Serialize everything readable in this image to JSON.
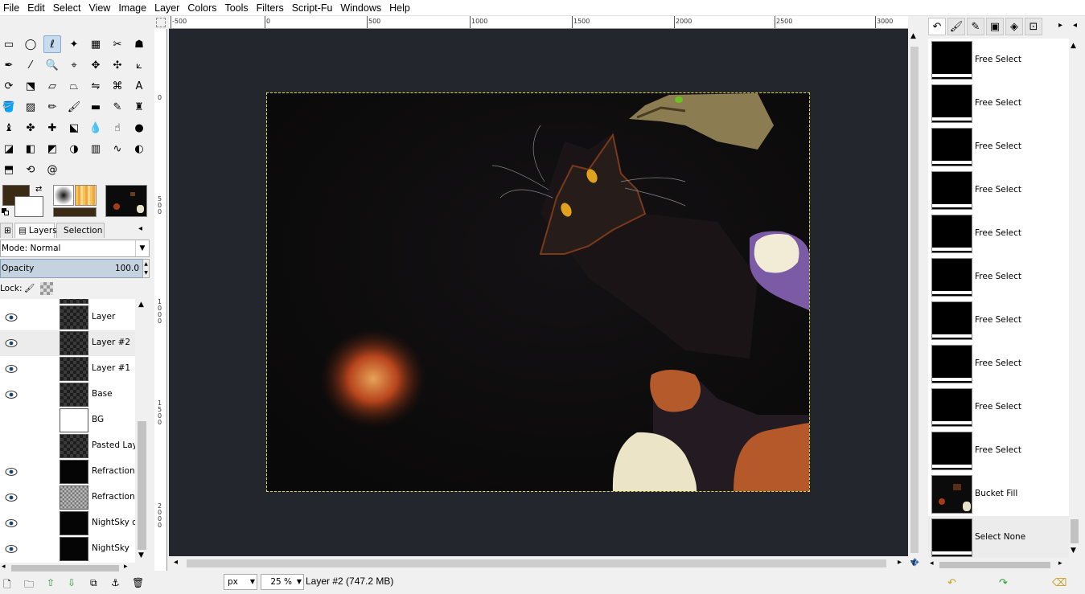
{
  "menu": [
    "File",
    "Edit",
    "Select",
    "View",
    "Image",
    "Layer",
    "Colors",
    "Tools",
    "Filters",
    "Script-Fu",
    "Windows",
    "Help"
  ],
  "toolbox": {
    "tools": [
      {
        "name": "rect-select-icon",
        "glyph": "▭"
      },
      {
        "name": "ellipse-select-icon",
        "glyph": "◯"
      },
      {
        "name": "free-select-icon",
        "glyph": "ℓ",
        "active": true
      },
      {
        "name": "fuzzy-select-icon",
        "glyph": "✦"
      },
      {
        "name": "select-by-color-icon",
        "glyph": "▦"
      },
      {
        "name": "scissors-select-icon",
        "glyph": "✂"
      },
      {
        "name": "foreground-select-icon",
        "glyph": "☗"
      },
      {
        "name": "paths-icon",
        "glyph": "✒"
      },
      {
        "name": "color-picker-icon",
        "glyph": "⁄"
      },
      {
        "name": "zoom-icon",
        "glyph": "🔍"
      },
      {
        "name": "measure-icon",
        "glyph": "⌖"
      },
      {
        "name": "move-icon",
        "glyph": "✥"
      },
      {
        "name": "alignment-icon",
        "glyph": "✣"
      },
      {
        "name": "crop-icon",
        "glyph": "⟀"
      },
      {
        "name": "rotate-icon",
        "glyph": "⟳"
      },
      {
        "name": "scale-icon",
        "glyph": "⬔"
      },
      {
        "name": "shear-icon",
        "glyph": "▱"
      },
      {
        "name": "perspective-icon",
        "glyph": "⏢"
      },
      {
        "name": "flip-icon",
        "glyph": "⇋"
      },
      {
        "name": "cage-transform-icon",
        "glyph": "⌘"
      },
      {
        "name": "text-icon",
        "glyph": "A"
      },
      {
        "name": "bucket-fill-icon",
        "glyph": "🪣"
      },
      {
        "name": "blend-icon",
        "glyph": "▨"
      },
      {
        "name": "pencil-icon",
        "glyph": "✏"
      },
      {
        "name": "paintbrush-icon",
        "glyph": "🖌"
      },
      {
        "name": "eraser-icon",
        "glyph": "▬"
      },
      {
        "name": "airbrush-icon",
        "glyph": "✎"
      },
      {
        "name": "ink-icon",
        "glyph": "♜"
      },
      {
        "name": "mypaint-brush-icon",
        "glyph": "♝"
      },
      {
        "name": "clone-icon",
        "glyph": "✤"
      },
      {
        "name": "heal-icon",
        "glyph": "✚"
      },
      {
        "name": "perspective-clone-icon",
        "glyph": "⬕"
      },
      {
        "name": "blur-icon",
        "glyph": "💧"
      },
      {
        "name": "smudge-icon",
        "glyph": "☝"
      },
      {
        "name": "dodge-burn-icon",
        "glyph": "●"
      },
      {
        "name": "warp-icon",
        "glyph": "◪"
      },
      {
        "name": "color-balance-icon",
        "glyph": "◧"
      },
      {
        "name": "hue-saturation-icon",
        "glyph": "◩"
      },
      {
        "name": "colorize-icon",
        "glyph": "◑"
      },
      {
        "name": "levels-icon",
        "glyph": "▥"
      },
      {
        "name": "curves-icon",
        "glyph": "∿"
      },
      {
        "name": "brightness-contrast-icon",
        "glyph": "◐"
      },
      {
        "name": "threshold-icon",
        "glyph": "⬒"
      },
      {
        "name": "desaturate-icon",
        "glyph": "⟲"
      },
      {
        "name": "spiral-icon",
        "glyph": "@"
      }
    ]
  },
  "colors": {
    "foreground": "#3b2b15",
    "background": "#ffffff",
    "accent": "#c9dcef"
  },
  "dock": {
    "tabs": [
      {
        "label": "Layers",
        "active": true
      },
      {
        "label": "Selection",
        "active": false
      }
    ],
    "mode_label": "Mode: Normal",
    "opacity_label": "Opacity",
    "opacity_value": "100.0",
    "lock_label": "Lock:",
    "layers": [
      {
        "name": "Layer",
        "visible": true,
        "thumb": "checker",
        "selected": false
      },
      {
        "name": "Layer #2",
        "visible": true,
        "thumb": "checker",
        "selected": true
      },
      {
        "name": "Layer #1",
        "visible": true,
        "thumb": "checker",
        "selected": false
      },
      {
        "name": "Base",
        "visible": true,
        "thumb": "checker",
        "selected": false
      },
      {
        "name": "BG",
        "visible": false,
        "thumb": "white",
        "selected": false
      },
      {
        "name": "Pasted Laye",
        "visible": false,
        "thumb": "checker",
        "selected": false
      },
      {
        "name": "RefractionL",
        "visible": true,
        "thumb": "black",
        "selected": false
      },
      {
        "name": "RefractionL",
        "visible": true,
        "thumb": "noise",
        "selected": false
      },
      {
        "name": "NightSky co",
        "visible": true,
        "thumb": "black",
        "selected": false
      },
      {
        "name": "NightSky",
        "visible": true,
        "thumb": "black",
        "selected": false
      }
    ]
  },
  "rulers": {
    "horizontal": [
      "-500",
      "0",
      "500",
      "1000",
      "1500",
      "2000",
      "2500",
      "3000"
    ],
    "vertical": [
      "0",
      "500",
      "1000",
      "1500",
      "2000"
    ]
  },
  "statusbar": {
    "unit": "px",
    "zoom": "25 %",
    "info": "Layer #2 (747.2 MB)"
  },
  "history": {
    "items": [
      {
        "label": "Free Select",
        "thumb": "black",
        "selected": false
      },
      {
        "label": "Free Select",
        "thumb": "black",
        "selected": false
      },
      {
        "label": "Free Select",
        "thumb": "black",
        "selected": false
      },
      {
        "label": "Free Select",
        "thumb": "black",
        "selected": false
      },
      {
        "label": "Free Select",
        "thumb": "black",
        "selected": false
      },
      {
        "label": "Free Select",
        "thumb": "black",
        "selected": false
      },
      {
        "label": "Free Select",
        "thumb": "black",
        "selected": false
      },
      {
        "label": "Free Select",
        "thumb": "black",
        "selected": false
      },
      {
        "label": "Free Select",
        "thumb": "black",
        "selected": false
      },
      {
        "label": "Free Select",
        "thumb": "black",
        "selected": false
      },
      {
        "label": "Bucket Fill",
        "thumb": "scene",
        "selected": false
      },
      {
        "label": "Select None",
        "thumb": "black",
        "selected": true
      }
    ]
  }
}
